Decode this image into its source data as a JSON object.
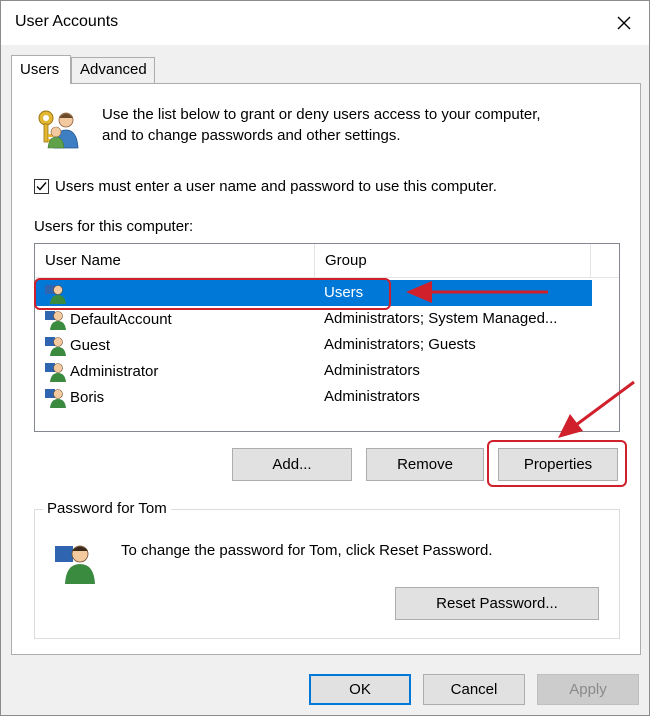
{
  "window": {
    "title": "User Accounts"
  },
  "tabs": [
    {
      "label": "Users",
      "active": true
    },
    {
      "label": "Advanced",
      "active": false
    }
  ],
  "intro": {
    "line1": "Use the list below to grant or deny users access to your computer,",
    "line2": "and to change passwords and other settings."
  },
  "checkbox": {
    "label": "Users must enter a user name and password to use this computer.",
    "checked": true
  },
  "users_section": {
    "label": "Users for this computer:"
  },
  "listview": {
    "columns": [
      "User Name",
      "Group"
    ],
    "rows": [
      {
        "name": "",
        "group": "Users",
        "selected": true
      },
      {
        "name": "DefaultAccount",
        "group": "Administrators; System Managed...",
        "selected": false
      },
      {
        "name": "Guest",
        "group": "Administrators; Guests",
        "selected": false
      },
      {
        "name": "Administrator",
        "group": "Administrators",
        "selected": false
      },
      {
        "name": "Boris",
        "group": "Administrators",
        "selected": false
      }
    ]
  },
  "user_buttons": {
    "add": "Add...",
    "remove": "Remove",
    "properties": "Properties"
  },
  "password_group": {
    "legend": "Password for Tom",
    "text": "To change the password for Tom, click Reset Password.",
    "reset_button": "Reset Password..."
  },
  "footer": {
    "ok": "OK",
    "cancel": "Cancel",
    "apply": "Apply",
    "apply_enabled": false
  },
  "colors": {
    "selection": "#0078d7",
    "annotation": "#d0202b"
  },
  "icons": {
    "close": "close-icon",
    "users_keys": "users-keys-icon",
    "user": "user-icon"
  }
}
